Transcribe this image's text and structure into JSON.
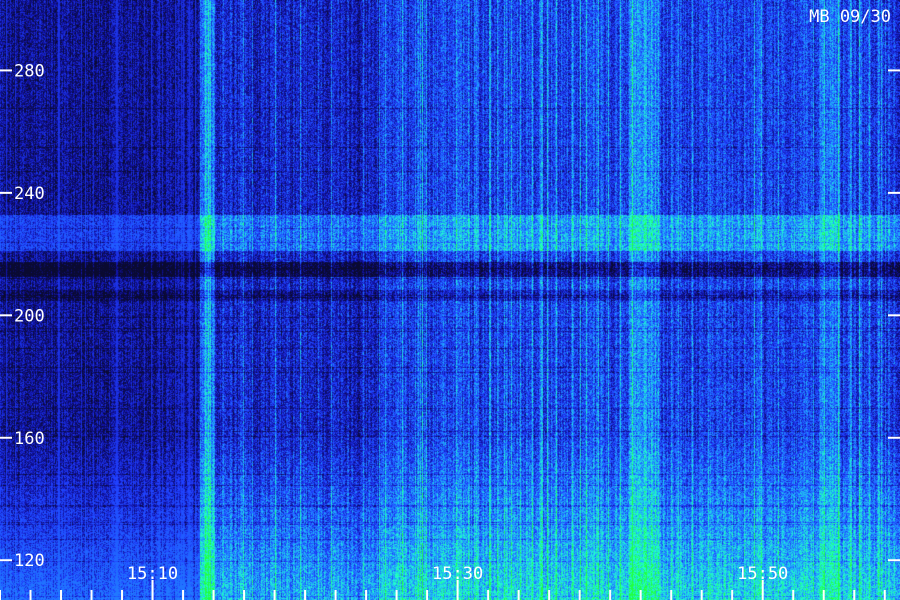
{
  "chart_data": {
    "type": "heatmap",
    "title": "MB 09/30",
    "xlabel": "",
    "ylabel": "",
    "y_ticks": [
      120,
      160,
      200,
      240,
      280
    ],
    "ylim": [
      107,
      303
    ],
    "x_ticks": [
      "15:10",
      "15:30",
      "15:50"
    ],
    "xlim": [
      "15:00",
      "15:59"
    ],
    "minor_x_tick_interval_min": 2,
    "colormap": [
      "#0a0a30",
      "#1010a0",
      "#2040ff",
      "#20a0ff",
      "#20ffd0",
      "#20ff40"
    ],
    "tick_color": "#ffffff",
    "grid": false,
    "legend": false
  }
}
